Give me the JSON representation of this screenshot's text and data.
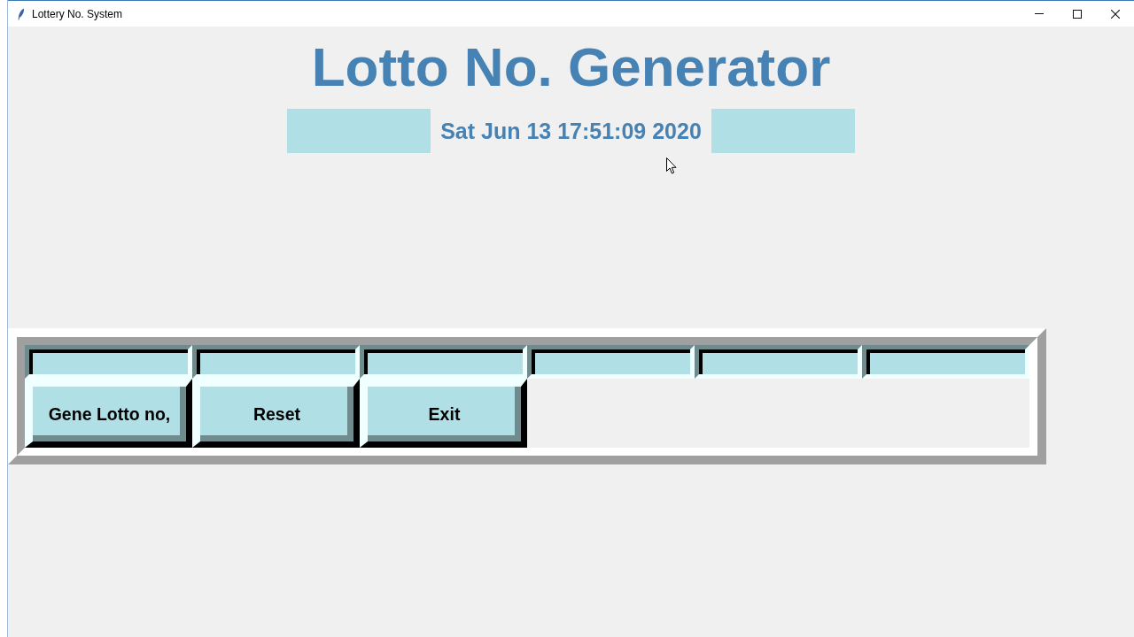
{
  "window": {
    "title": "Lottery No. System"
  },
  "heading": "Lotto No. Generator",
  "clock_bar": [
    {
      "kind": "panel"
    },
    {
      "kind": "text",
      "text": "Sat Jun 13 17:51:09 2020"
    },
    {
      "kind": "panel"
    }
  ],
  "entry_fields": [
    {
      "kind": "entry"
    },
    {
      "kind": "entry"
    },
    {
      "kind": "entry"
    },
    {
      "kind": "entry"
    },
    {
      "kind": "entry"
    },
    {
      "kind": "entry"
    }
  ],
  "buttons": [
    {
      "label": "Gene Lotto no,"
    },
    {
      "label": "Reset"
    },
    {
      "label": "Exit"
    }
  ]
}
